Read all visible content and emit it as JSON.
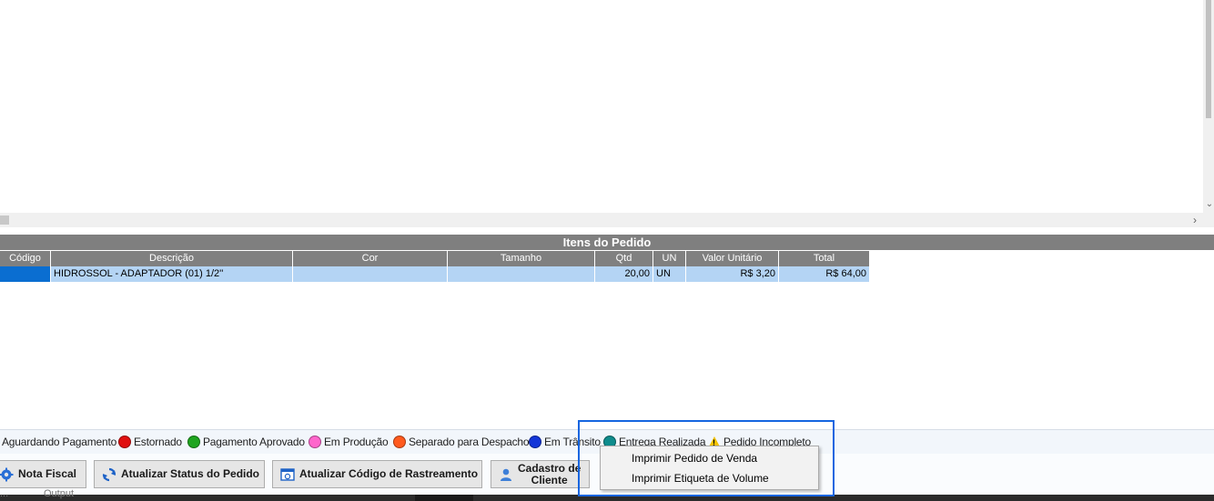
{
  "items_panel": {
    "title": "Itens do Pedido",
    "columns": [
      "Código",
      "Descrição",
      "Cor",
      "Tamanho",
      "Qtd",
      "UN",
      "Valor Unitário",
      "Total"
    ],
    "rows": [
      [
        "",
        "HIDROSSOL - ADAPTADOR (01) 1/2''",
        "",
        "",
        "20,00",
        "UN",
        "R$ 3,20",
        "R$ 64,00"
      ]
    ]
  },
  "legend": {
    "items": [
      {
        "label": "Aguardando Pagamento"
      },
      {
        "label": "Estornado",
        "color": "#e01010"
      },
      {
        "label": "Pagamento Aprovado",
        "color": "#1fa51f"
      },
      {
        "label": "Em Produção",
        "color": "#ff66cc"
      },
      {
        "label": "Separado para Despacho",
        "color": "#ff5a1e"
      },
      {
        "label": "Em Trânsito",
        "color": "#1436d8"
      },
      {
        "label": "Entrega Realizada",
        "color": "#0f8c8c"
      },
      {
        "label": "Pedido Incompleto",
        "icon": "warning-icon"
      }
    ]
  },
  "buttons": {
    "nota_fiscal": "Nota Fiscal",
    "atualizar_status": "Atualizar Status do Pedido",
    "atualizar_rastreamento": "Atualizar Código de Rastreamento",
    "cadastro_cliente_line1": "Cadastro de",
    "cadastro_cliente_line2": "Cliente"
  },
  "context_menu": {
    "items": [
      "Imprimir Pedido de Venda",
      "Imprimir Etiqueta de Volume"
    ]
  },
  "bottom_strip": {
    "text_left": "...",
    "text_output": "Output"
  },
  "colors": {
    "header_gray": "#7f7f7f",
    "row_selected": "#b4d4f4",
    "highlight_border": "#1565e0"
  }
}
